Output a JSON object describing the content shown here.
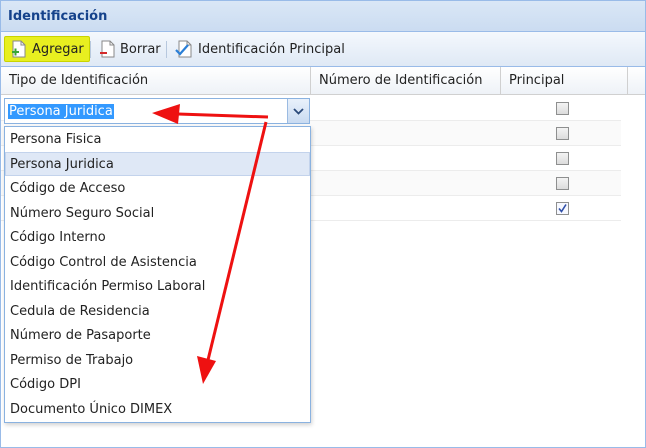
{
  "panel": {
    "title": "Identificación"
  },
  "toolbar": {
    "add_label": "Agregar",
    "delete_label": "Borrar",
    "primary_label": "Identificación Principal"
  },
  "grid": {
    "columns": [
      "Tipo de Identificación",
      "Número de Identificación",
      "Principal"
    ],
    "principal_checked": [
      false,
      false,
      false,
      false,
      true
    ]
  },
  "combo": {
    "value": "Persona Juridica"
  },
  "dropdown": {
    "selected_index": 1,
    "options": [
      "Persona Fisica",
      "Persona Juridica",
      "Código de Acceso",
      "Número Seguro Social",
      "Código Interno",
      "Código Control de Asistencia",
      "Identificación Permiso Laboral",
      "Cedula de Residencia",
      "Número de Pasaporte",
      "Permiso de Trabajo",
      "Código DPI",
      "Documento Único DIMEX"
    ]
  },
  "colors": {
    "header_text": "#15428b",
    "highlight": "#e8ef20",
    "annotation_arrow": "#ee1111",
    "selection": "#3399ff"
  },
  "icons": [
    "add-icon",
    "delete-icon",
    "primary-id-icon",
    "chevron-down-icon",
    "checkbox-icon"
  ]
}
